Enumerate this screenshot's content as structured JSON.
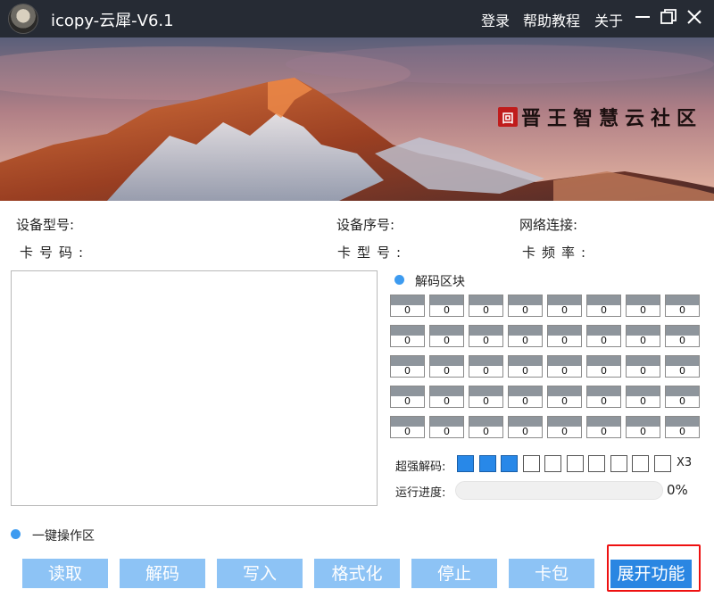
{
  "titlebar": {
    "title": "icopy-云犀-V6.1",
    "menu": [
      "登录",
      "帮助教程",
      "关于"
    ],
    "window_controls": [
      "minimize-icon",
      "restore-icon",
      "close-icon"
    ],
    "background_color": "#262b34"
  },
  "banner": {
    "brand_mark": "回",
    "brand_text": "晋王智慧云社区"
  },
  "info": {
    "device_model": "设备型号:",
    "device_serial": "设备序号:",
    "network": "网络连接:",
    "card_number": "卡号码:",
    "card_type": "卡型号:",
    "card_freq": "卡频率:"
  },
  "decode": {
    "title": "解码区块",
    "blocks": [
      [
        "0",
        "0",
        "0",
        "0",
        "0",
        "0",
        "0",
        "0"
      ],
      [
        "0",
        "0",
        "0",
        "0",
        "0",
        "0",
        "0",
        "0"
      ],
      [
        "0",
        "0",
        "0",
        "0",
        "0",
        "0",
        "0",
        "0"
      ],
      [
        "0",
        "0",
        "0",
        "0",
        "0",
        "0",
        "0",
        "0"
      ],
      [
        "0",
        "0",
        "0",
        "0",
        "0",
        "0",
        "0",
        "0"
      ]
    ],
    "super_label": "超强解码:",
    "super_filled": 3,
    "super_total": 10,
    "multiplier": "X3",
    "progress_label": "运行进度:",
    "progress_value": "0%",
    "progress_fraction": 0
  },
  "oneclick": {
    "title": "一键操作区",
    "buttons": [
      "读取",
      "解码",
      "写入",
      "格式化",
      "停止",
      "卡包",
      "展开功能"
    ]
  },
  "colors": {
    "accent": "#2a86e2",
    "button_light": "#8dc3f5",
    "dot": "#3d9bf0",
    "highlight": "#ee1111"
  }
}
